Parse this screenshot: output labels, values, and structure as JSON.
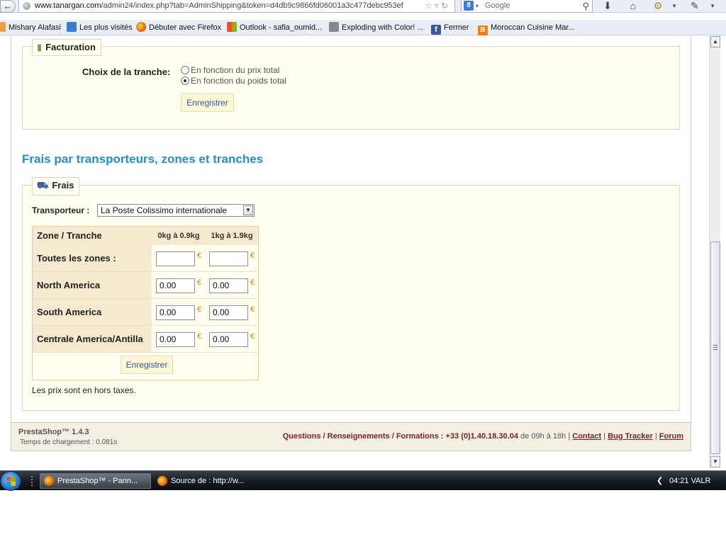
{
  "browser": {
    "url_domain": "www.tanargan.com",
    "url_path": "/admin24/index.php?tab=AdminShipping&token=d4db9c9866fd06001a3c477debc953ef",
    "search_placeholder": "Google",
    "search_engine_label": "8"
  },
  "bookmarks": [
    {
      "label": "Mishary Alafasi",
      "icon": "page-icon",
      "color": "#e8a23a"
    },
    {
      "label": "Les plus visités",
      "icon": "bookmark-folder-icon",
      "color": "#3a7bd5"
    },
    {
      "label": "Débuter avec Firefox",
      "icon": "firefox-icon",
      "color": "#e36a00"
    },
    {
      "label": "Outlook - safia_oumid...",
      "icon": "windows-logo-icon",
      "color": "#f25022"
    },
    {
      "label": "Exploding with Color! ...",
      "icon": "image-icon",
      "color": "#888888"
    },
    {
      "label": "Fermer",
      "icon": "facebook-icon",
      "color": "#3b5998"
    },
    {
      "label": "Moroccan Cuisine Mar...",
      "icon": "blogger-icon",
      "color": "#f57d00"
    }
  ],
  "billing": {
    "legend": "Facturation",
    "choice_label": "Choix de la tranche:",
    "options": [
      {
        "label": "En fonction du prix total",
        "selected": false
      },
      {
        "label": "En fonction du poids total",
        "selected": true
      }
    ],
    "save_label": "Enregistrer"
  },
  "fees_section": {
    "title": "Frais par transporteurs, zones et tranches",
    "legend": "Frais",
    "carrier_label": "Transporteur :",
    "carrier_value": "La Poste Colissimo internationale",
    "table": {
      "header_zone": "Zone / Tranche",
      "ranges": [
        "0kg à 0.9kg",
        "1kg à 1.9kg"
      ],
      "currency": "€",
      "rows": [
        {
          "zone": "Toutes les zones :",
          "values": [
            "",
            ""
          ]
        },
        {
          "zone": "North America",
          "values": [
            "0.00",
            "0.00"
          ]
        },
        {
          "zone": "South America",
          "values": [
            "0.00",
            "0.00"
          ]
        },
        {
          "zone": "Centrale America/Antilla",
          "values": [
            "0.00",
            "0.00"
          ]
        }
      ]
    },
    "save_label": "Enregistrer",
    "tax_note": "Les prix sont en hors taxes."
  },
  "footer": {
    "version": "PrestaShop™ 1.4.3",
    "load_time": "Temps de chargement : 0.081s",
    "links_prefix": "Questions / Renseignements / Formations :",
    "phone": "+33 (0)1.40.18.30.04",
    "hours": "de 09h à 18h |",
    "contact": "Contact",
    "bug_tracker": "Bug Tracker",
    "forum": "Forum",
    "sep": "|"
  },
  "taskbar": {
    "tasks": [
      "PrestaShop™ - Pann...",
      "Source de : http://w..."
    ],
    "clock": "04:21 VALR"
  },
  "colors": {
    "accent_title": "#268ccd",
    "panel_bg": "#fffff0",
    "footer_link": "#7b1d2e"
  }
}
